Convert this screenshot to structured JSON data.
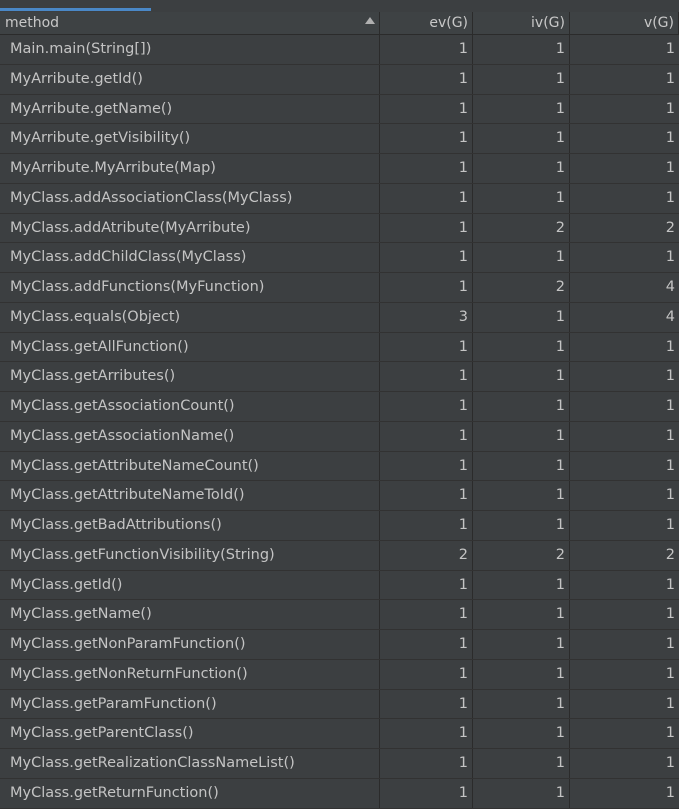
{
  "header": {
    "method": "method",
    "ev": "ev(G)",
    "iv": "iv(G)",
    "v": "v(G)"
  },
  "rows": [
    {
      "method": "Main.main(String[])",
      "ev": "1",
      "iv": "1",
      "v": "1"
    },
    {
      "method": "MyArribute.getId()",
      "ev": "1",
      "iv": "1",
      "v": "1"
    },
    {
      "method": "MyArribute.getName()",
      "ev": "1",
      "iv": "1",
      "v": "1"
    },
    {
      "method": "MyArribute.getVisibility()",
      "ev": "1",
      "iv": "1",
      "v": "1"
    },
    {
      "method": "MyArribute.MyArribute(Map)",
      "ev": "1",
      "iv": "1",
      "v": "1"
    },
    {
      "method": "MyClass.addAssociationClass(MyClass)",
      "ev": "1",
      "iv": "1",
      "v": "1"
    },
    {
      "method": "MyClass.addAtribute(MyArribute)",
      "ev": "1",
      "iv": "2",
      "v": "2"
    },
    {
      "method": "MyClass.addChildClass(MyClass)",
      "ev": "1",
      "iv": "1",
      "v": "1"
    },
    {
      "method": "MyClass.addFunctions(MyFunction)",
      "ev": "1",
      "iv": "2",
      "v": "4"
    },
    {
      "method": "MyClass.equals(Object)",
      "ev": "3",
      "iv": "1",
      "v": "4"
    },
    {
      "method": "MyClass.getAllFunction()",
      "ev": "1",
      "iv": "1",
      "v": "1"
    },
    {
      "method": "MyClass.getArributes()",
      "ev": "1",
      "iv": "1",
      "v": "1"
    },
    {
      "method": "MyClass.getAssociationCount()",
      "ev": "1",
      "iv": "1",
      "v": "1"
    },
    {
      "method": "MyClass.getAssociationName()",
      "ev": "1",
      "iv": "1",
      "v": "1"
    },
    {
      "method": "MyClass.getAttributeNameCount()",
      "ev": "1",
      "iv": "1",
      "v": "1"
    },
    {
      "method": "MyClass.getAttributeNameToId()",
      "ev": "1",
      "iv": "1",
      "v": "1"
    },
    {
      "method": "MyClass.getBadAttributions()",
      "ev": "1",
      "iv": "1",
      "v": "1"
    },
    {
      "method": "MyClass.getFunctionVisibility(String)",
      "ev": "2",
      "iv": "2",
      "v": "2"
    },
    {
      "method": "MyClass.getId()",
      "ev": "1",
      "iv": "1",
      "v": "1"
    },
    {
      "method": "MyClass.getName()",
      "ev": "1",
      "iv": "1",
      "v": "1"
    },
    {
      "method": "MyClass.getNonParamFunction()",
      "ev": "1",
      "iv": "1",
      "v": "1"
    },
    {
      "method": "MyClass.getNonReturnFunction()",
      "ev": "1",
      "iv": "1",
      "v": "1"
    },
    {
      "method": "MyClass.getParamFunction()",
      "ev": "1",
      "iv": "1",
      "v": "1"
    },
    {
      "method": "MyClass.getParentClass()",
      "ev": "1",
      "iv": "1",
      "v": "1"
    },
    {
      "method": "MyClass.getRealizationClassNameList()",
      "ev": "1",
      "iv": "1",
      "v": "1"
    },
    {
      "method": "MyClass.getReturnFunction()",
      "ev": "1",
      "iv": "1",
      "v": "1"
    }
  ],
  "icons": {
    "sort": "sort-ascending-icon"
  },
  "colors": {
    "background": "#3c3f41",
    "tab_accent": "#4a88c7",
    "grid": "#2b2b2b"
  }
}
